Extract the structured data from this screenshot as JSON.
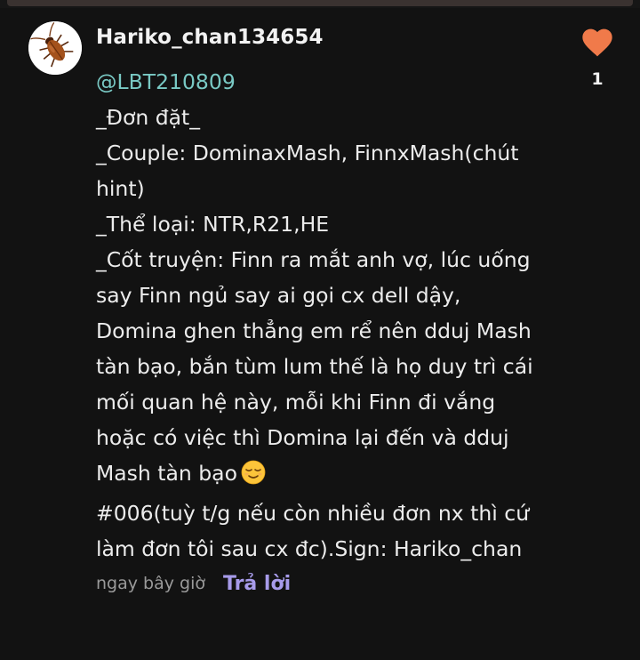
{
  "comment": {
    "username": "Hariko_chan134654",
    "avatar_icon": "cockroach-icon",
    "mention": "@LBT210809",
    "lines": [
      "_Đơn đặt_",
      "_Couple: DominaxMash, FinnxMash(chút",
      "hint)",
      "_Thể loại: NTR,R21,HE",
      "_Cốt truyện: Finn ra mắt anh vợ, lúc uống",
      "say Finn ngủ say ai gọi cx dell dậy,",
      "Domina ghen thẳng em rể nên dduj Mash",
      "tàn bạo, bắn tùm lum thế là họ duy trì cái",
      "mối quan hệ này, mỗi khi Finn đi vắng",
      "hoặc có việc thì Domina lại đến và dduj",
      "Mash tàn bạo",
      "#006(tuỳ t/g nếu còn nhiều đơn nx thì cứ",
      "làm đơn tôi sau cx đc).Sign: Hariko_chan"
    ],
    "emoji_icon": "relieved-face-emoji",
    "timestamp": "ngay bây giờ",
    "reply_label": "Trả lời",
    "like_icon": "heart-icon",
    "like_count": "1"
  },
  "colors": {
    "background": "#121212",
    "text": "#ececec",
    "mention": "#79c9c4",
    "reply": "#a79bea",
    "heart": "#f07a4a",
    "timestamp": "#9a9a9a"
  }
}
